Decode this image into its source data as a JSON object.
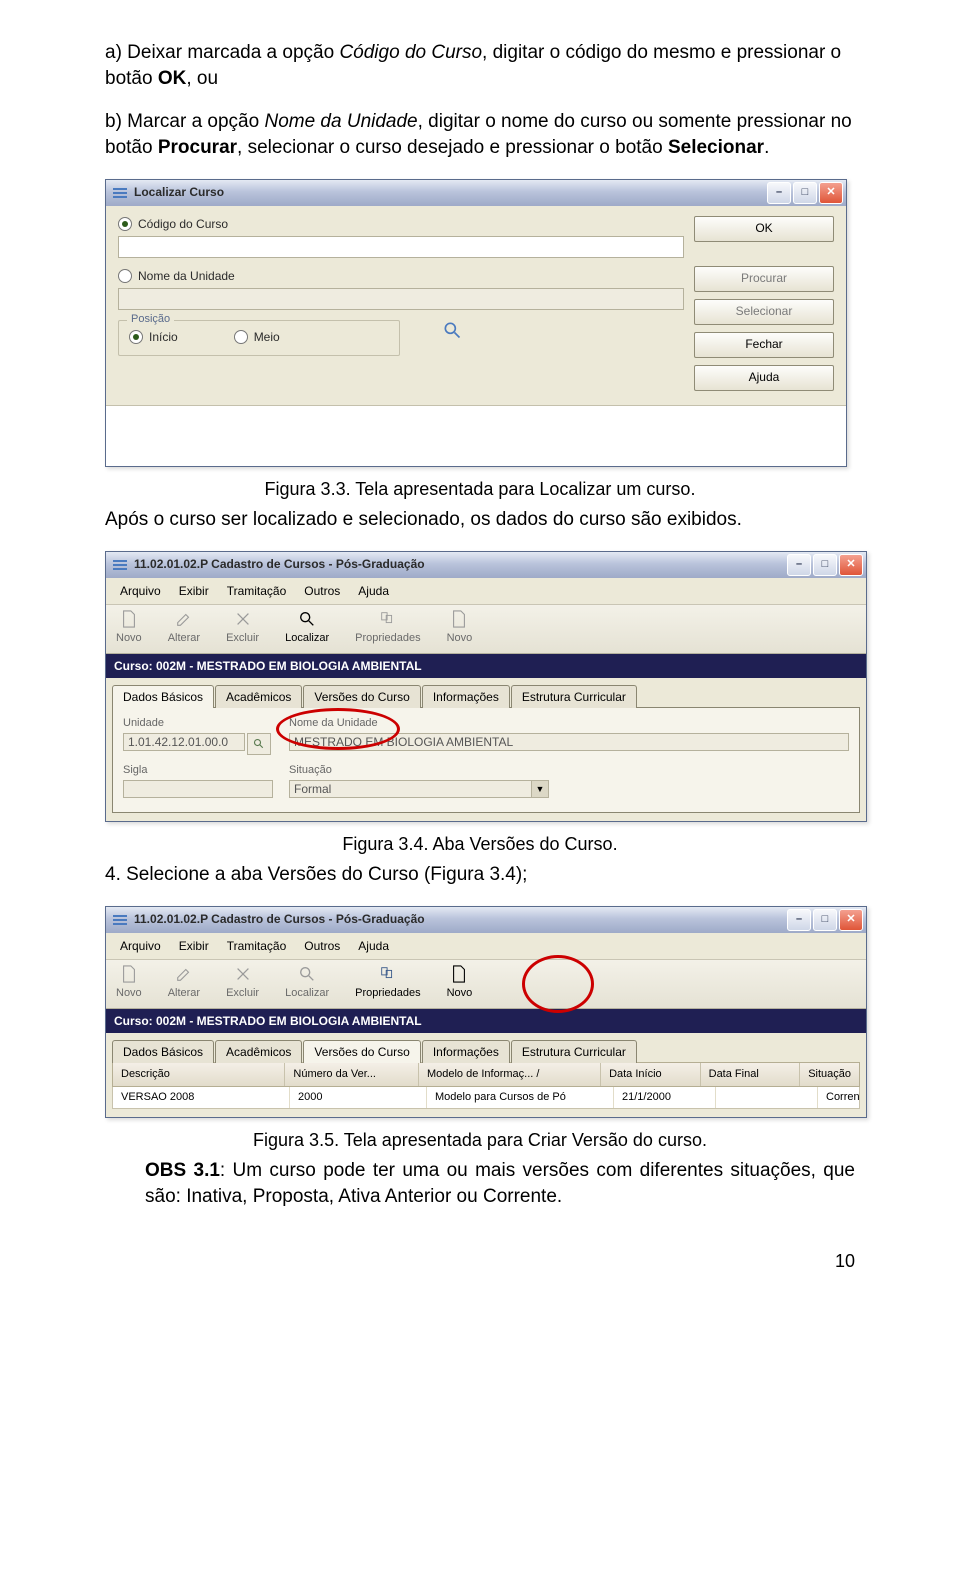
{
  "para_a": {
    "prefix": "a) Deixar marcada a opção ",
    "codigo": "Código do Curso",
    "mid1": ", digitar o código do mesmo e pressionar o botão ",
    "ok": "OK",
    "suffix": ", ou"
  },
  "para_b": {
    "prefix": "b) Marcar a opção ",
    "nome": "Nome da Unidade",
    "mid1": ", digitar o nome do curso ou somente pressionar no botão ",
    "procurar": "Procurar",
    "mid2": ", selecionar o curso desejado e pressionar o botão ",
    "selecionar": "Selecionar",
    "suffix": "."
  },
  "loc": {
    "title": "Localizar Curso",
    "codLabel": "Código do Curso",
    "nomeLabel": "Nome da Unidade",
    "posLegend": "Posição",
    "inicio": "Início",
    "meio": "Meio",
    "btn_ok": "OK",
    "btn_procurar": "Procurar",
    "btn_selecionar": "Selecionar",
    "btn_fechar": "Fechar",
    "btn_ajuda": "Ajuda"
  },
  "caption1": "Figura 3.3. Tela apresentada para Localizar um curso.",
  "after1": "Após o curso ser localizado e selecionado, os dados do curso são exibidos.",
  "cad": {
    "title": "11.02.01.02.P Cadastro de Cursos - Pós-Graduação",
    "menu": [
      "Arquivo",
      "Exibir",
      "Tramitação",
      "Outros",
      "Ajuda"
    ],
    "tool": {
      "novo": "Novo",
      "alterar": "Alterar",
      "excluir": "Excluir",
      "localizar": "Localizar",
      "prop": "Propriedades",
      "novo2": "Novo"
    },
    "curso": "Curso: 002M - MESTRADO EM BIOLOGIA AMBIENTAL",
    "tabs": [
      "Dados Básicos",
      "Acadêmicos",
      "Versões do Curso",
      "Informações",
      "Estrutura Curricular"
    ],
    "unidadeLbl": "Unidade",
    "nomeLbl": "Nome da Unidade",
    "siglaLbl": "Sigla",
    "situacaoLbl": "Situação",
    "unidadeVal": "1.01.42.12.01.00.0",
    "nomeVal": "MESTRADO EM BIOLOGIA AMBIENTAL",
    "situacaoVal": "Formal",
    "th": {
      "desc": "Descrição",
      "num": "Número da Ver...",
      "modelo": "Modelo de Informaç...  /",
      "dini": "Data Início",
      "dfim": "Data Final",
      "sit": "Situação"
    },
    "row": {
      "desc": "VERSAO 2008",
      "num": "2000",
      "modelo": "Modelo para Cursos de Pó",
      "dini": "21/1/2000",
      "dfim": "",
      "sit": "Corrente"
    }
  },
  "caption2": "Figura 3.4. Aba Versões do Curso.",
  "step4": "4. Selecione a aba Versões do Curso (Figura 3.4);",
  "caption3": "Figura 3.5. Tela apresentada para Criar Versão do curso.",
  "obs": {
    "prefix": "OBS 3.1",
    "rest": ": Um curso pode ter uma ou mais versões com diferentes situações, que são: Inativa, Proposta, Ativa Anterior ou Corrente."
  },
  "pagenum": "10"
}
